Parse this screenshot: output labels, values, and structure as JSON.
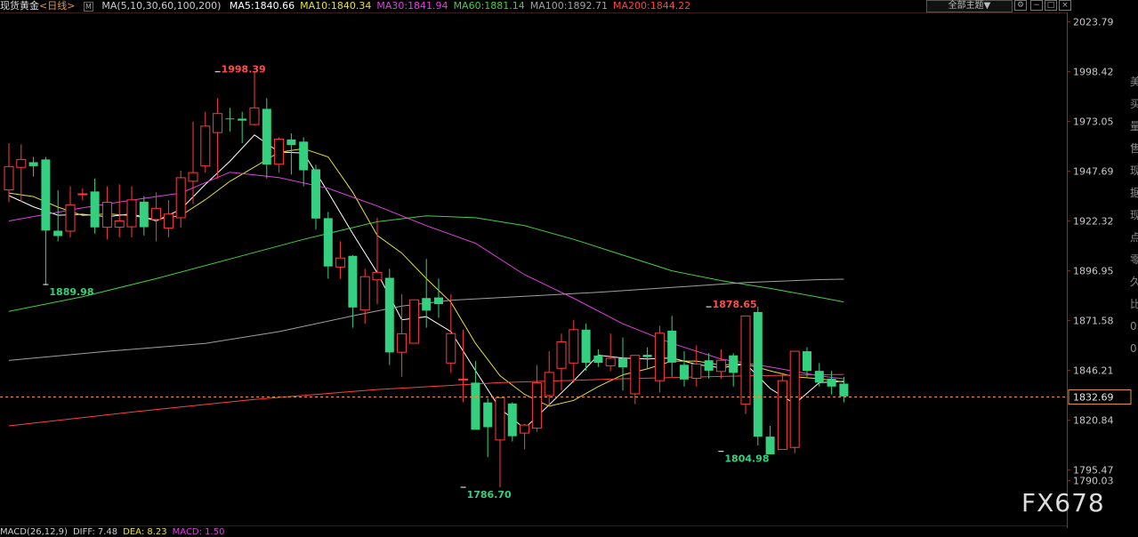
{
  "header": {
    "instrument": "现货黄金",
    "period": "<日线>",
    "ma_params": "MA(5,10,30,60,100,200)",
    "ma_values": [
      {
        "text": "MA5:1840.66",
        "color": "#ffffff"
      },
      {
        "text": "MA10:1840.34",
        "color": "#e8e030"
      },
      {
        "text": "MA30:1841.94",
        "color": "#e040e0"
      },
      {
        "text": "MA60:1881.14",
        "color": "#40d040"
      },
      {
        "text": "MA100:1892.71",
        "color": "#a0a0a0"
      },
      {
        "text": "MA200:1844.22",
        "color": "#ff4040"
      }
    ],
    "theme_button": "全部主题▼"
  },
  "footer": {
    "items": [
      {
        "text": "MACD(26,12,9)",
        "color": "#cccccc"
      },
      {
        "text": "DIFF: 7.48",
        "color": "#cccccc"
      },
      {
        "text": "DEA: 8.23",
        "color": "#e8e030"
      },
      {
        "text": "MACD: 1.50",
        "color": "#e040e0"
      }
    ]
  },
  "watermark": "FX678",
  "side_glyphs": [
    "美",
    "买",
    "量",
    "售",
    "现",
    "据",
    "现",
    "点",
    "零",
    "久",
    "比",
    "0",
    "0"
  ],
  "colors": {
    "up": "#ff3b3b",
    "down": "#35d07f",
    "grid": "#2a2a2a",
    "axis_text": "#c8c8c8",
    "current_price_line": "#e8943a"
  },
  "chart_data": {
    "type": "candlestick",
    "y_axis": {
      "ticks": [
        2023.79,
        1998.42,
        1973.05,
        1947.69,
        1922.32,
        1896.95,
        1871.58,
        1846.21,
        1820.84,
        1795.47,
        1790.03
      ],
      "range": [
        1783.1,
        2026.8
      ]
    },
    "current_price": 1832.69,
    "annotations": [
      {
        "label": "1998.39",
        "index": 17,
        "value": 1998.39,
        "kind": "high"
      },
      {
        "label": "1889.98",
        "index": 3,
        "value": 1889.98,
        "kind": "low"
      },
      {
        "label": "1786.70",
        "index": 37,
        "value": 1786.7,
        "kind": "low"
      },
      {
        "label": "1878.65",
        "index": 57,
        "value": 1878.65,
        "kind": "high"
      },
      {
        "label": "1804.98",
        "index": 58,
        "value": 1804.98,
        "kind": "low"
      }
    ],
    "candles": [
      {
        "o": 1938.2,
        "h": 1962.0,
        "c": 1950.1,
        "l": 1932.0
      },
      {
        "o": 1949.7,
        "h": 1961.4,
        "c": 1953.7,
        "l": 1932.0
      },
      {
        "o": 1952.3,
        "h": 1955.0,
        "c": 1950.3,
        "l": 1945.0
      },
      {
        "o": 1953.7,
        "h": 1955.0,
        "c": 1917.5,
        "l": 1889.98
      },
      {
        "o": 1917.4,
        "h": 1938.0,
        "c": 1914.7,
        "l": 1912.0
      },
      {
        "o": 1917.2,
        "h": 1940.0,
        "c": 1930.6,
        "l": 1914.0
      },
      {
        "o": 1936.2,
        "h": 1939.0,
        "c": 1936.2,
        "l": 1933.0
      },
      {
        "o": 1937.4,
        "h": 1944.0,
        "c": 1919.1,
        "l": 1916.0
      },
      {
        "o": 1919.2,
        "h": 1940.0,
        "c": 1931.9,
        "l": 1913.0
      },
      {
        "o": 1919.2,
        "h": 1941.0,
        "c": 1922.4,
        "l": 1914.0
      },
      {
        "o": 1919.4,
        "h": 1940.0,
        "c": 1933.1,
        "l": 1914.0
      },
      {
        "o": 1932.2,
        "h": 1935.0,
        "c": 1919.2,
        "l": 1915.0
      },
      {
        "o": 1923.1,
        "h": 1937.0,
        "c": 1928.8,
        "l": 1912.0
      },
      {
        "o": 1918.8,
        "h": 1933.0,
        "c": 1925.9,
        "l": 1914.0
      },
      {
        "o": 1924.0,
        "h": 1948.0,
        "c": 1944.4,
        "l": 1919.0
      },
      {
        "o": 1942.6,
        "h": 1973.0,
        "c": 1947.0,
        "l": 1931.0
      },
      {
        "o": 1950.4,
        "h": 1978.0,
        "c": 1970.7,
        "l": 1947.0
      },
      {
        "o": 1967.4,
        "h": 1985.0,
        "c": 1977.1,
        "l": 1944.0
      },
      {
        "o": 1974.6,
        "h": 1980.0,
        "c": 1974.5,
        "l": 1968.0
      },
      {
        "o": 1974.5,
        "h": 1978.0,
        "c": 1973.5,
        "l": 1962.0
      },
      {
        "o": 1971.5,
        "h": 1998.39,
        "c": 1980.0,
        "l": 1971.0
      },
      {
        "o": 1979.5,
        "h": 1985.0,
        "c": 1951.1,
        "l": 1944.0
      },
      {
        "o": 1951.3,
        "h": 1965.0,
        "c": 1964.1,
        "l": 1947.0
      },
      {
        "o": 1963.9,
        "h": 1967.0,
        "c": 1961.1,
        "l": 1946.0
      },
      {
        "o": 1962.8,
        "h": 1965.0,
        "c": 1948.2,
        "l": 1940.0
      },
      {
        "o": 1948.7,
        "h": 1951.0,
        "c": 1923.6,
        "l": 1918.0
      },
      {
        "o": 1923.8,
        "h": 1927.0,
        "c": 1899.2,
        "l": 1893.0
      },
      {
        "o": 1898.9,
        "h": 1912.0,
        "c": 1903.5,
        "l": 1893.0
      },
      {
        "o": 1904.6,
        "h": 1905.0,
        "c": 1878.3,
        "l": 1868.0
      },
      {
        "o": 1877.0,
        "h": 1898.0,
        "c": 1894.0,
        "l": 1870.0
      },
      {
        "o": 1892.4,
        "h": 1924.0,
        "c": 1896.2,
        "l": 1880.0
      },
      {
        "o": 1893.4,
        "h": 1898.0,
        "c": 1855.4,
        "l": 1849.0
      },
      {
        "o": 1855.5,
        "h": 1885.0,
        "c": 1864.9,
        "l": 1843.0
      },
      {
        "o": 1860.1,
        "h": 1882.0,
        "c": 1882.2,
        "l": 1860.0
      },
      {
        "o": 1883.1,
        "h": 1903.0,
        "c": 1876.7,
        "l": 1868.0
      },
      {
        "o": 1883.4,
        "h": 1893.0,
        "c": 1880.0,
        "l": 1873.0
      },
      {
        "o": 1850.0,
        "h": 1885.0,
        "c": 1865.0,
        "l": 1845.0
      },
      {
        "o": 1841.5,
        "h": 1867.0,
        "c": 1841.8,
        "l": 1830.0
      },
      {
        "o": 1840.0,
        "h": 1851.0,
        "c": 1816.0,
        "l": 1816.0
      },
      {
        "o": 1829.9,
        "h": 1832.0,
        "c": 1817.3,
        "l": 1802.0
      },
      {
        "o": 1810.8,
        "h": 1832.0,
        "c": 1832.3,
        "l": 1786.7
      },
      {
        "o": 1829.4,
        "h": 1830.0,
        "c": 1812.7,
        "l": 1810.0
      },
      {
        "o": 1814.3,
        "h": 1819.0,
        "c": 1818.4,
        "l": 1806.0
      },
      {
        "o": 1816.8,
        "h": 1849.0,
        "c": 1839.9,
        "l": 1815.0
      },
      {
        "o": 1833.4,
        "h": 1856.0,
        "c": 1845.2,
        "l": 1828.0
      },
      {
        "o": 1847.3,
        "h": 1865.0,
        "c": 1860.8,
        "l": 1836.0
      },
      {
        "o": 1850.0,
        "h": 1872.0,
        "c": 1867.0,
        "l": 1840.0
      },
      {
        "o": 1867.0,
        "h": 1870.0,
        "c": 1850.1,
        "l": 1846.0
      },
      {
        "o": 1853.8,
        "h": 1857.0,
        "c": 1850.1,
        "l": 1848.0
      },
      {
        "o": 1848.6,
        "h": 1865.0,
        "c": 1852.4,
        "l": 1846.0
      },
      {
        "o": 1852.4,
        "h": 1863.0,
        "c": 1847.8,
        "l": 1836.0
      },
      {
        "o": 1834.3,
        "h": 1850.0,
        "c": 1853.9,
        "l": 1829.0
      },
      {
        "o": 1854.2,
        "h": 1858.0,
        "c": 1853.0,
        "l": 1847.0
      },
      {
        "o": 1841.0,
        "h": 1869.0,
        "c": 1865.2,
        "l": 1835.0
      },
      {
        "o": 1866.5,
        "h": 1874.0,
        "c": 1850.2,
        "l": 1843.0
      },
      {
        "o": 1849.1,
        "h": 1856.0,
        "c": 1841.6,
        "l": 1838.0
      },
      {
        "o": 1842.2,
        "h": 1859.0,
        "c": 1849.5,
        "l": 1838.0
      },
      {
        "o": 1851.4,
        "h": 1855.0,
        "c": 1846.1,
        "l": 1842.0
      },
      {
        "o": 1845.7,
        "h": 1857.0,
        "c": 1851.4,
        "l": 1842.0
      },
      {
        "o": 1853.9,
        "h": 1855.0,
        "c": 1845.0,
        "l": 1838.0
      },
      {
        "o": 1829.0,
        "h": 1874.0,
        "c": 1874.0,
        "l": 1824.0
      },
      {
        "o": 1876.0,
        "h": 1878.65,
        "c": 1812.5,
        "l": 1808.0
      },
      {
        "o": 1812.5,
        "h": 1818.0,
        "c": 1803.5,
        "l": 1804.98
      },
      {
        "o": 1806.0,
        "h": 1845.0,
        "c": 1841.0,
        "l": 1806.0
      },
      {
        "o": 1807.0,
        "h": 1856.0,
        "c": 1856.0,
        "l": 1804.0
      },
      {
        "o": 1856.0,
        "h": 1858.0,
        "c": 1846.0,
        "l": 1843.0
      },
      {
        "o": 1846.0,
        "h": 1850.0,
        "c": 1840.0,
        "l": 1838.0
      },
      {
        "o": 1842.0,
        "h": 1846.0,
        "c": 1838.0,
        "l": 1834.0
      },
      {
        "o": 1839.5,
        "h": 1843.0,
        "c": 1833.0,
        "l": 1830.0
      }
    ],
    "ma_series": [
      {
        "name": "MA5",
        "color": "#ffffff",
        "points": [
          [
            0,
            1935.3
          ],
          [
            2,
            1929.6
          ],
          [
            4,
            1925.3
          ],
          [
            6,
            1925.8
          ],
          [
            8,
            1924.5
          ],
          [
            10,
            1926.0
          ],
          [
            12,
            1922.4
          ],
          [
            14,
            1928.3
          ],
          [
            16,
            1941.0
          ],
          [
            18,
            1952.8
          ],
          [
            20,
            1966.2
          ],
          [
            22,
            1957.5
          ],
          [
            24,
            1957.0
          ],
          [
            26,
            1937.0
          ],
          [
            28,
            1916.0
          ],
          [
            30,
            1896.0
          ],
          [
            32,
            1872.0
          ],
          [
            34,
            1873.6
          ],
          [
            36,
            1866.0
          ],
          [
            38,
            1846.1
          ],
          [
            40,
            1826.8
          ],
          [
            42,
            1816.6
          ],
          [
            44,
            1828.7
          ],
          [
            46,
            1840.9
          ],
          [
            48,
            1854.0
          ],
          [
            50,
            1852.5
          ],
          [
            52,
            1852.1
          ],
          [
            54,
            1852.6
          ],
          [
            56,
            1849.3
          ],
          [
            58,
            1847.5
          ],
          [
            60,
            1849.6
          ],
          [
            62,
            1837.0
          ],
          [
            64,
            1829.2
          ],
          [
            66,
            1840.0
          ],
          [
            68,
            1840.66
          ]
        ]
      },
      {
        "name": "MA10",
        "color": "#e8e030",
        "points": [
          [
            0,
            1936.6
          ],
          [
            2,
            1934.8
          ],
          [
            4,
            1929.4
          ],
          [
            6,
            1925.2
          ],
          [
            8,
            1926.0
          ],
          [
            10,
            1925.1
          ],
          [
            12,
            1923.1
          ],
          [
            14,
            1925.1
          ],
          [
            16,
            1933.2
          ],
          [
            18,
            1942.6
          ],
          [
            20,
            1949.9
          ],
          [
            22,
            1957.4
          ],
          [
            24,
            1959.2
          ],
          [
            26,
            1955.0
          ],
          [
            28,
            1937.0
          ],
          [
            30,
            1915.0
          ],
          [
            32,
            1906.0
          ],
          [
            34,
            1893.0
          ],
          [
            36,
            1881.0
          ],
          [
            38,
            1860.0
          ],
          [
            40,
            1843.5
          ],
          [
            42,
            1834.0
          ],
          [
            44,
            1828.0
          ],
          [
            46,
            1831.0
          ],
          [
            48,
            1838.0
          ],
          [
            50,
            1844.0
          ],
          [
            52,
            1847.0
          ],
          [
            54,
            1851.0
          ],
          [
            56,
            1851.0
          ],
          [
            58,
            1849.0
          ],
          [
            60,
            1849.5
          ],
          [
            62,
            1846.0
          ],
          [
            64,
            1843.0
          ],
          [
            66,
            1842.0
          ],
          [
            68,
            1840.34
          ]
        ]
      },
      {
        "name": "MA30",
        "color": "#e040e0",
        "points": [
          [
            0,
            1922.4
          ],
          [
            6,
            1929.1
          ],
          [
            10,
            1933.0
          ],
          [
            14,
            1936.6
          ],
          [
            18,
            1947.2
          ],
          [
            22,
            1944.5
          ],
          [
            26,
            1939.0
          ],
          [
            30,
            1930.0
          ],
          [
            34,
            1920.0
          ],
          [
            38,
            1911.0
          ],
          [
            42,
            1895.0
          ],
          [
            46,
            1883.0
          ],
          [
            50,
            1870.0
          ],
          [
            54,
            1860.0
          ],
          [
            58,
            1852.0
          ],
          [
            62,
            1848.0
          ],
          [
            66,
            1843.5
          ],
          [
            68,
            1841.94
          ]
        ]
      },
      {
        "name": "MA60",
        "color": "#40d040",
        "points": [
          [
            0,
            1876.3
          ],
          [
            6,
            1883.8
          ],
          [
            12,
            1893.0
          ],
          [
            18,
            1903.0
          ],
          [
            24,
            1913.0
          ],
          [
            30,
            1922.0
          ],
          [
            34,
            1925.0
          ],
          [
            38,
            1924.0
          ],
          [
            42,
            1920.0
          ],
          [
            46,
            1913.0
          ],
          [
            50,
            1905.0
          ],
          [
            54,
            1897.0
          ],
          [
            58,
            1892.0
          ],
          [
            62,
            1888.0
          ],
          [
            66,
            1883.5
          ],
          [
            68,
            1881.14
          ]
        ]
      },
      {
        "name": "MA100",
        "color": "#a0a0a0",
        "points": [
          [
            0,
            1851.3
          ],
          [
            8,
            1856.0
          ],
          [
            16,
            1860.0
          ],
          [
            22,
            1866.0
          ],
          [
            28,
            1874.0
          ],
          [
            32,
            1879.0
          ],
          [
            36,
            1882.0
          ],
          [
            42,
            1884.0
          ],
          [
            48,
            1886.0
          ],
          [
            54,
            1888.5
          ],
          [
            60,
            1891.0
          ],
          [
            66,
            1892.5
          ],
          [
            68,
            1892.71
          ]
        ]
      },
      {
        "name": "MA200",
        "color": "#ff4040",
        "points": [
          [
            0,
            1818.0
          ],
          [
            10,
            1825.0
          ],
          [
            20,
            1831.5
          ],
          [
            30,
            1836.5
          ],
          [
            40,
            1840.0
          ],
          [
            50,
            1842.0
          ],
          [
            60,
            1843.5
          ],
          [
            68,
            1844.22
          ]
        ]
      }
    ]
  }
}
